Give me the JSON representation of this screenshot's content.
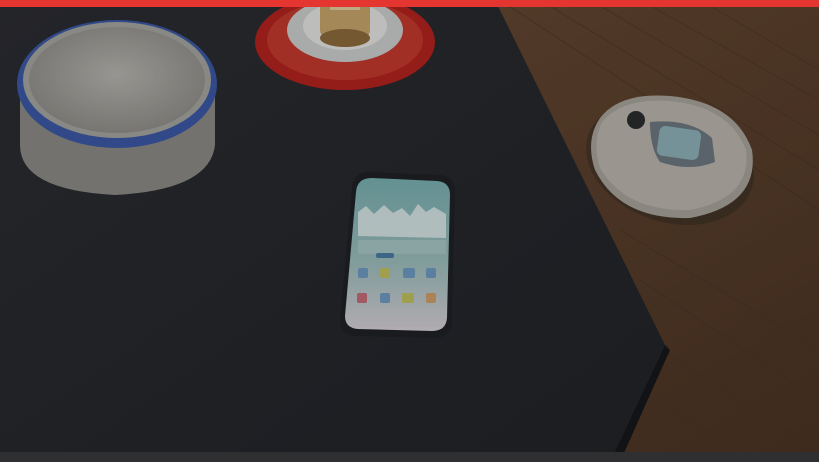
{
  "colors": {
    "accent_bar": "#e53531",
    "wood_floor": "#6b4b34",
    "table_top": "#2a2c30",
    "speaker_body": "#9d9b96",
    "speaker_ring": "#3c59a8",
    "robot_body": "#aaa79f",
    "phone_screen": "#8fb7b9",
    "cup_saucer": "#b5231f"
  },
  "objects": {
    "smart_speaker": "smart-speaker",
    "smartphone": "smartphone",
    "robot_vacuum": "robot-vacuum",
    "coffee_cup": "coffee-cup"
  }
}
